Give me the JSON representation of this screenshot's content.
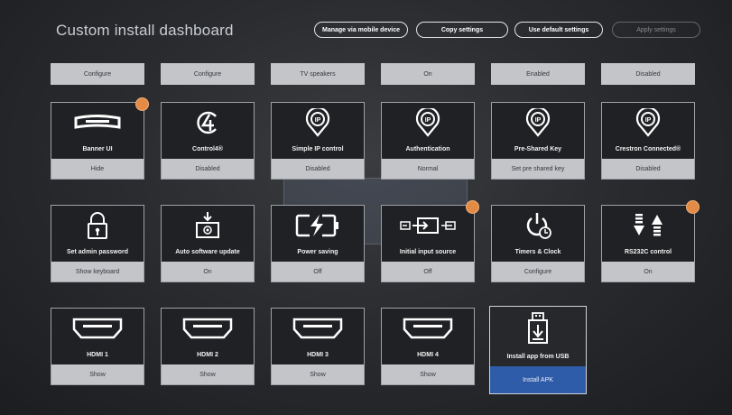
{
  "title": "Custom install dashboard",
  "top_buttons": {
    "manage": "Manage via mobile device",
    "copy": "Copy settings",
    "default": "Use default settings",
    "apply": "Apply settings"
  },
  "top_values": [
    "Configure",
    "Configure",
    "TV speakers",
    "On",
    "Enabled",
    "Disabled"
  ],
  "cards": [
    {
      "label": "Banner UI",
      "value": "Hide",
      "icon": "banner-icon"
    },
    {
      "label": "Control4®",
      "value": "Disabled",
      "icon": "control4-icon"
    },
    {
      "label": "Simple IP control",
      "value": "Disabled",
      "icon": "ip-pin-icon"
    },
    {
      "label": "Authentication",
      "value": "Normal",
      "icon": "ip-pin-icon"
    },
    {
      "label": "Pre-Shared Key",
      "value": "Set pre shared key",
      "icon": "ip-pin-icon"
    },
    {
      "label": "Crestron Connected®",
      "value": "Disabled",
      "icon": "ip-pin-icon"
    },
    {
      "label": "Set admin password",
      "value": "Show keyboard",
      "icon": "lock-icon"
    },
    {
      "label": "Auto software update",
      "value": "On",
      "icon": "download-icon"
    },
    {
      "label": "Power saving",
      "value": "Off",
      "icon": "battery-icon"
    },
    {
      "label": "Initial input source",
      "value": "Off",
      "icon": "input-source-icon"
    },
    {
      "label": "Timers & Clock",
      "value": "Configure",
      "icon": "timer-clock-icon"
    },
    {
      "label": "RS232C control",
      "value": "On",
      "icon": "rs232c-icon"
    },
    {
      "label": "HDMI 1",
      "value": "Show",
      "icon": "hdmi-icon"
    },
    {
      "label": "HDMI 2",
      "value": "Show",
      "icon": "hdmi-icon"
    },
    {
      "label": "HDMI 3",
      "value": "Show",
      "icon": "hdmi-icon"
    },
    {
      "label": "HDMI 4",
      "value": "Show",
      "icon": "hdmi-icon"
    },
    {
      "label": "Install app from USB",
      "value": "Install APK",
      "icon": "usb-install-icon"
    }
  ],
  "colors": {
    "accent_selected": "#2f5ca8",
    "badge": "#e38a44"
  }
}
